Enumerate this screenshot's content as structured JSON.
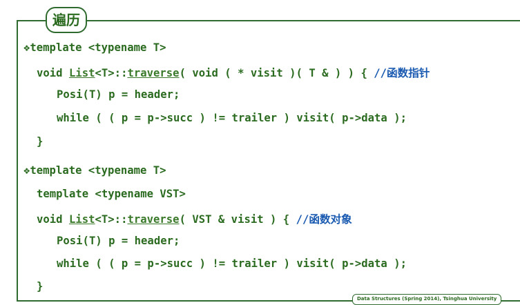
{
  "slide_title": "遍历",
  "bullet_symbol": "❖",
  "block1": {
    "l1_rest": "template <typename T>",
    "l2_a": "void ",
    "l2_list": "List",
    "l2_b": "<T>::",
    "l2_traverse": "traverse",
    "l2_c": "( void ( * visit )( T & ) ) { ",
    "l2_comment": "//函数指针",
    "l3": "Posi(T) p = header;",
    "l4": "while ( ( p = p->succ ) != trailer ) visit( p->data );",
    "l5": "}"
  },
  "block2": {
    "l1_rest": "template <typename T>",
    "l2": "template <typename VST>",
    "l3_a": "void ",
    "l3_list": "List",
    "l3_b": "<T>::",
    "l3_traverse": "traverse",
    "l3_c": "( VST & visit ) { ",
    "l3_comment": "//函数对象",
    "l4": "Posi(T) p = header;",
    "l5": "while ( ( p = p->succ ) != trailer ) visit( p->data );",
    "l6": "}"
  },
  "footer": "Data Structures (Spring 2014), Tsinghua University",
  "colors": {
    "code": "#2b6b20",
    "comment": "#1a5ab0",
    "border": "#2f6b2f"
  }
}
